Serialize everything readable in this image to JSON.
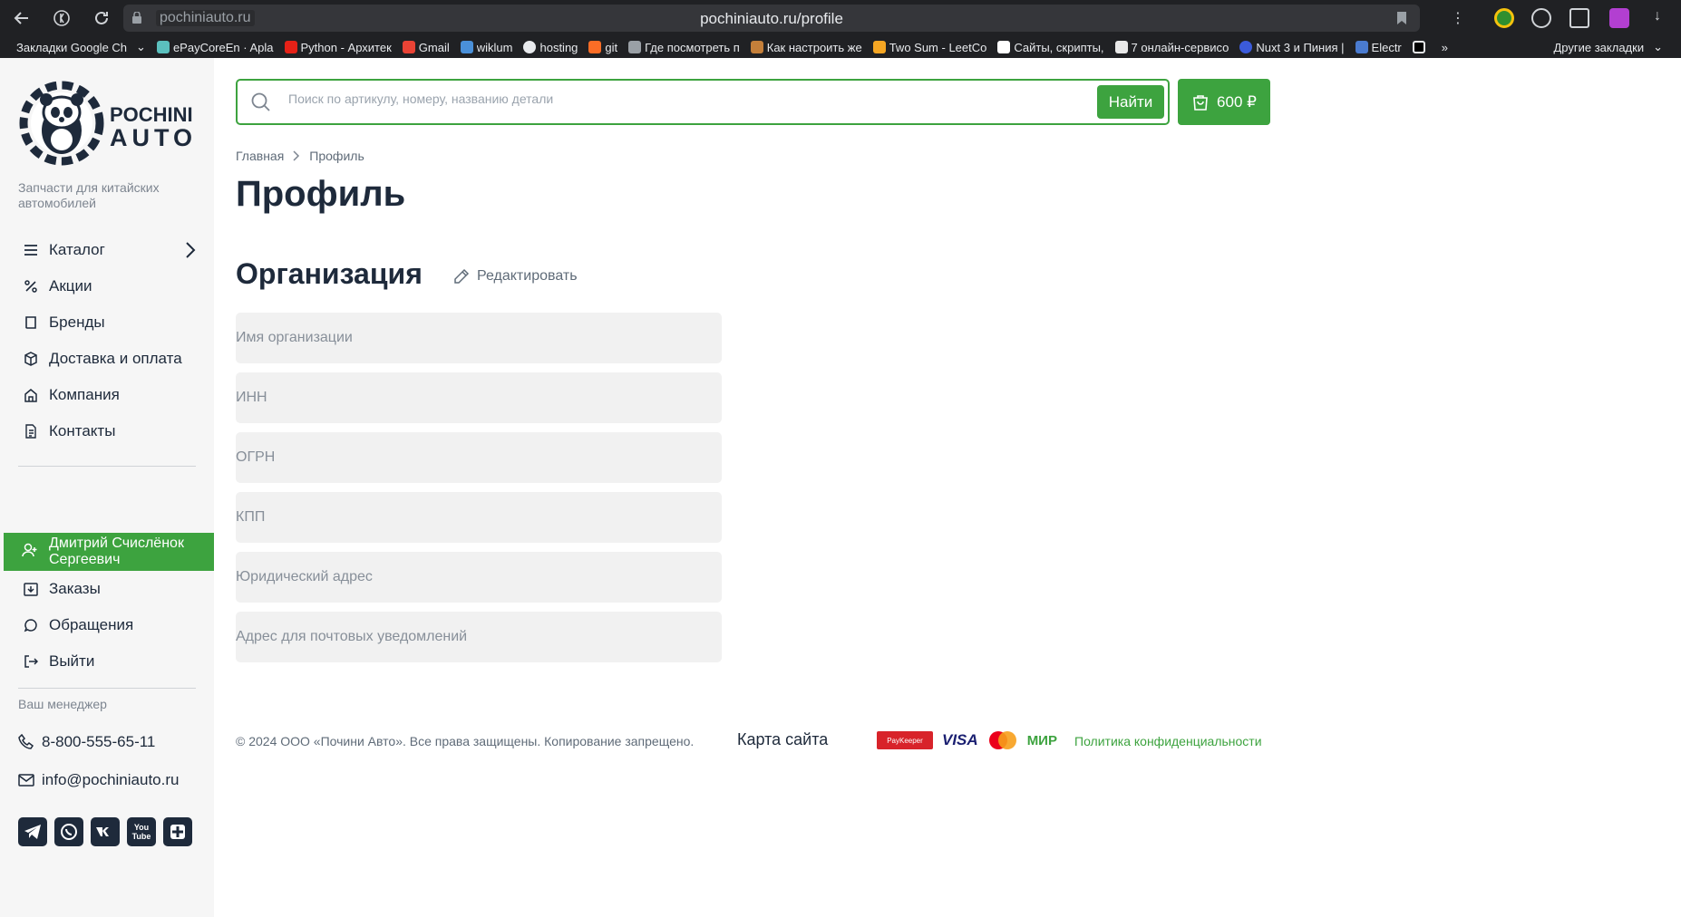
{
  "browser": {
    "host": "pochiniauto.ru",
    "url": "pochiniauto.ru/profile",
    "bookmarks": [
      "Закладки Google Ch",
      "ePayCoreEn · Apla",
      "Python - Архитек",
      "Gmail",
      "wiklum",
      "hosting",
      "git",
      "Где посмотреть п",
      "Как настроить же",
      "Two Sum - LeetCo",
      "Сайты, скрипты, ",
      "7 онлайн-сервисо",
      "Nuxt 3 и Пиния | ",
      "Electr"
    ],
    "more_bookmarks": "»",
    "other_bookmarks": "Другие закладки"
  },
  "sidebar": {
    "logo_line1": "POCHINI",
    "logo_line2": "AUTO",
    "tagline": "Запчасти для китайских автомобилей",
    "menu": [
      {
        "label": "Каталог",
        "icon": "menu-icon"
      },
      {
        "label": "Акции",
        "icon": "percent-icon"
      },
      {
        "label": "Бренды",
        "icon": "book-icon"
      },
      {
        "label": "Доставка и оплата",
        "icon": "box-icon"
      },
      {
        "label": "Компания",
        "icon": "home-icon"
      },
      {
        "label": "Контакты",
        "icon": "document-icon"
      }
    ],
    "user_name": "Дмитрий Счислёнок Сергеевич",
    "account_menu": [
      {
        "label": "Заказы",
        "icon": "orders-icon"
      },
      {
        "label": "Обращения",
        "icon": "chat-icon"
      },
      {
        "label": "Выйти",
        "icon": "logout-icon"
      }
    ],
    "manager_label": "Ваш менеджер",
    "phone": "8-800-555-65-11",
    "email": "info@pochiniauto.ru",
    "socials": [
      "telegram-icon",
      "whatsapp-icon",
      "vk-icon",
      "youtube-icon",
      "dzen-icon"
    ]
  },
  "header": {
    "search_placeholder": "Поиск по артикулу, номеру, названию детали",
    "search_button": "Найти",
    "cart_total": "600 ₽"
  },
  "breadcrumb": {
    "home": "Главная",
    "current": "Профиль"
  },
  "page_title": "Профиль",
  "organization": {
    "title": "Организация",
    "edit_label": "Редактировать",
    "fields": [
      {
        "placeholder": "Имя организации",
        "value": ""
      },
      {
        "placeholder": "ИНН",
        "value": ""
      },
      {
        "placeholder": "ОГРН",
        "value": ""
      },
      {
        "placeholder": "КПП",
        "value": ""
      },
      {
        "placeholder": "Юридический адрес",
        "value": ""
      },
      {
        "placeholder": "Адрес для почтовых уведомлений",
        "value": ""
      }
    ]
  },
  "footer": {
    "copyright": "© 2024 ООО «Почини Авто». Все права защищены. Копирование запрещено.",
    "sitemap": "Карта сайта",
    "payments": [
      "PayKeeper",
      "VISA",
      "Mastercard",
      "МИР"
    ],
    "privacy": "Политика конфиденциальности"
  },
  "colors": {
    "accent": "#3da33f",
    "text": "#1e2a3b",
    "sidebar_bg": "#f6f6f6",
    "field_bg": "#f1f1f1"
  }
}
